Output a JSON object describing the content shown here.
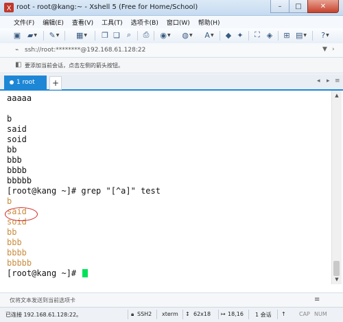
{
  "window": {
    "title": "root - root@kang:~ - Xshell 5 (Free for Home/School)",
    "controls": {
      "minimize": "–",
      "maximize": "□",
      "close": "✕"
    }
  },
  "menu": [
    "文件(F)",
    "编辑(E)",
    "查看(V)",
    "工具(T)",
    "选项卡(B)",
    "窗口(W)",
    "帮助(H)"
  ],
  "address": {
    "text": "ssh://root:********@192.168.61.128:22"
  },
  "hint": {
    "text": "要添加当前会话，点击左侧的箭头按钮。"
  },
  "tabs": {
    "active_label": "1 root",
    "add_label": "+"
  },
  "terminal": {
    "lines": [
      {
        "text": "aaaaa",
        "style": "plain"
      },
      {
        "text": "",
        "style": "plain"
      },
      {
        "text": "b",
        "style": "plain"
      },
      {
        "text": "said",
        "style": "plain"
      },
      {
        "text": "soid",
        "style": "plain"
      },
      {
        "text": "bb",
        "style": "plain"
      },
      {
        "text": "bbb",
        "style": "plain"
      },
      {
        "text": "bbbb",
        "style": "plain"
      },
      {
        "text": "bbbbb",
        "style": "plain"
      },
      {
        "text": "[root@kang ~]# grep \"[^a]\" test",
        "style": "plain"
      },
      {
        "text": "b",
        "style": "out"
      },
      {
        "text": "said",
        "style": "out"
      },
      {
        "text": "soid",
        "style": "out"
      },
      {
        "text": "bb",
        "style": "out"
      },
      {
        "text": "bbb",
        "style": "out"
      },
      {
        "text": "bbbb",
        "style": "out"
      },
      {
        "text": "bbbbb",
        "style": "out"
      },
      {
        "text": "[root@kang ~]# ",
        "style": "prompt"
      }
    ]
  },
  "compose": {
    "placeholder": "仅将文本发送到当前选项卡"
  },
  "status": {
    "connection": "已连接 192.168.61.128:22。",
    "protocol": "SSH2",
    "terminal_type": "xterm",
    "size": "62x18",
    "cursor_pos": "18,16",
    "sessions": "1 会话",
    "caps": "CAP",
    "num": "NUM"
  },
  "colors": {
    "tab_active": "#1d87d6",
    "terminal_output": "#c98c3d",
    "cursor": "#00e25a",
    "highlight_circle": "#d12a2a"
  }
}
